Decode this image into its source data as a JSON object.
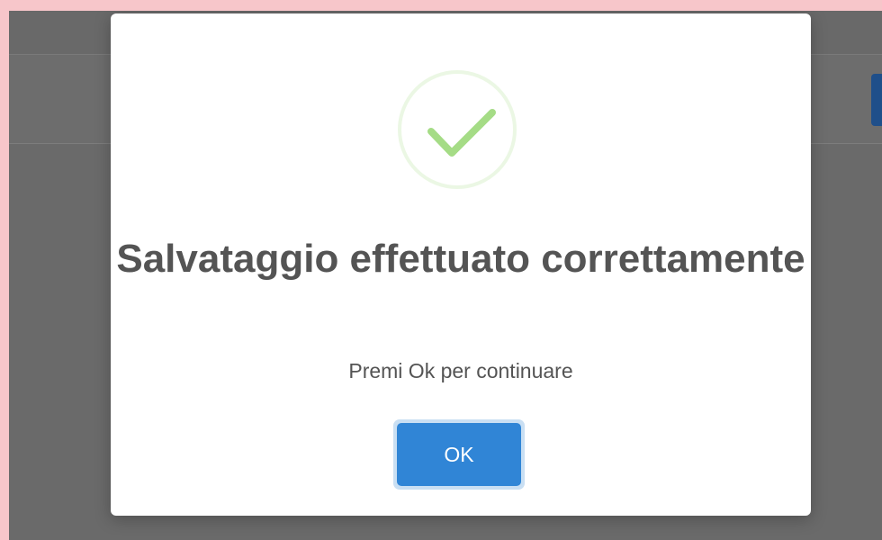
{
  "dialog": {
    "icon": "check-success-icon",
    "title": "Salvataggio effettuato correttamente",
    "message": "Premi Ok per continuare",
    "confirm_label": "OK"
  },
  "colors": {
    "confirm_button": "#3085d6",
    "success_check": "#a5dc86",
    "overlay": "#6b6b6b",
    "frame": "#f7c6ca"
  }
}
